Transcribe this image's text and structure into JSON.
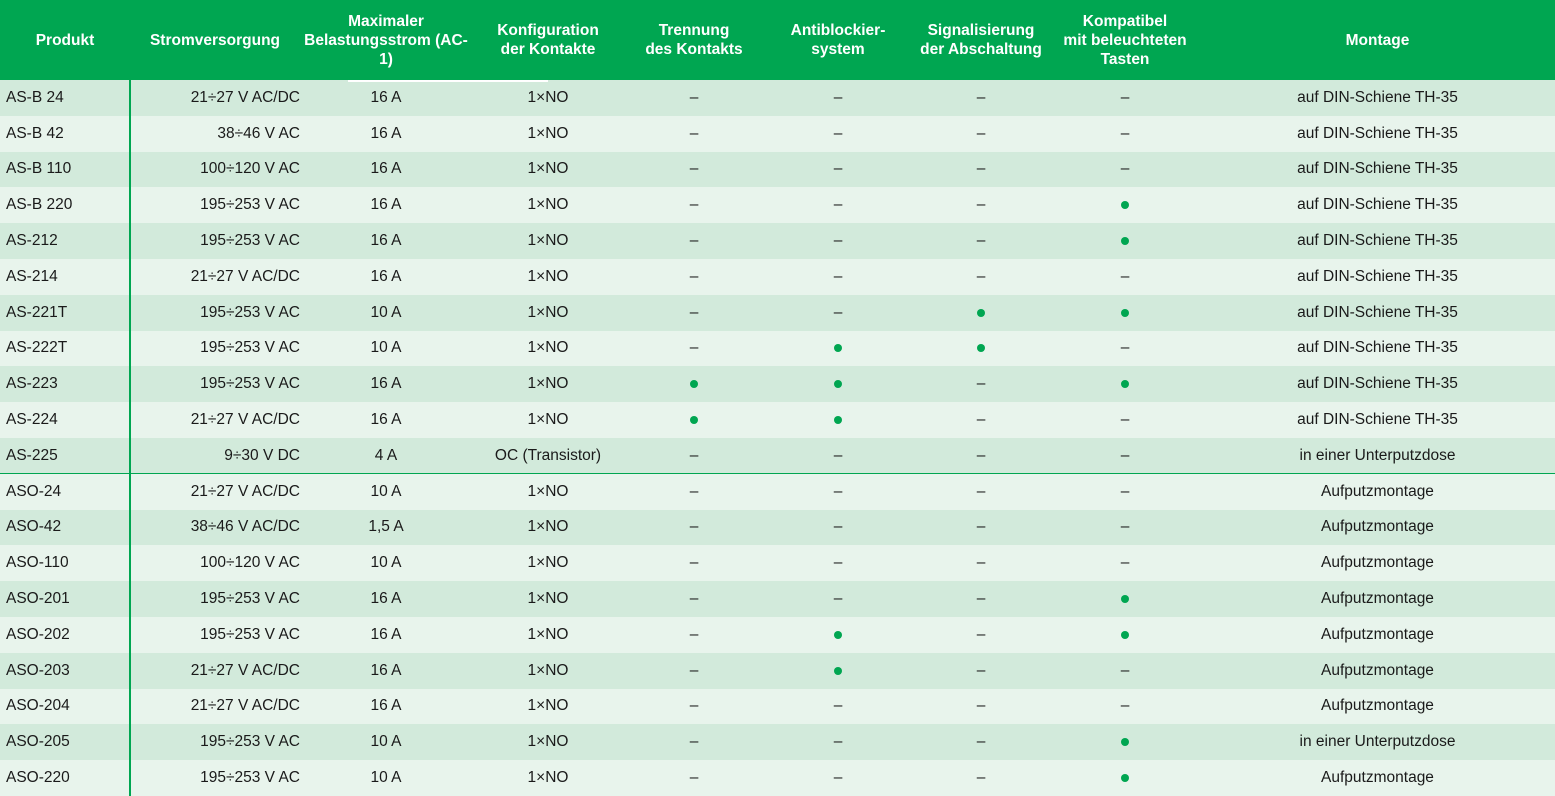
{
  "headers": [
    "Produkt",
    "Stromversorgung",
    "Maximaler\nBelastungsstrom (AC-1)",
    "Konfiguration\nder Kontakte",
    "Trennung\ndes Kontakts",
    "Antiblockier-\nsystem",
    "Signalisierung\nder Abschaltung",
    "Kompatibel\nmit beleuchteten\nTasten",
    "Montage"
  ],
  "legend": {
    "yes": "dot",
    "no": "–"
  },
  "colors": {
    "header_bg": "#00a651",
    "row_dark": "#d2eadb",
    "row_light": "#e8f4ec",
    "dot": "#00a651"
  },
  "rows": [
    {
      "produkt": "AS-B 24",
      "strom": "21÷27 V AC/DC",
      "last": "16 A",
      "konf": "1×NO",
      "trenn": "–",
      "anti": "–",
      "signal": "–",
      "kompat": "–",
      "montage": "auf DIN-Schiene TH-35"
    },
    {
      "produkt": "AS-B 42",
      "strom": "38÷46 V AC",
      "last": "16 A",
      "konf": "1×NO",
      "trenn": "–",
      "anti": "–",
      "signal": "–",
      "kompat": "–",
      "montage": "auf DIN-Schiene TH-35"
    },
    {
      "produkt": "AS-B 110",
      "strom": "100÷120 V AC",
      "last": "16 A",
      "konf": "1×NO",
      "trenn": "–",
      "anti": "–",
      "signal": "–",
      "kompat": "–",
      "montage": "auf DIN-Schiene TH-35"
    },
    {
      "produkt": "AS-B 220",
      "strom": "195÷253 V AC",
      "last": "16 A",
      "konf": "1×NO",
      "trenn": "–",
      "anti": "–",
      "signal": "–",
      "kompat": "dot",
      "montage": "auf DIN-Schiene TH-35"
    },
    {
      "produkt": "AS-212",
      "strom": "195÷253 V AC",
      "last": "16 A",
      "konf": "1×NO",
      "trenn": "–",
      "anti": "–",
      "signal": "–",
      "kompat": "dot",
      "montage": "auf DIN-Schiene TH-35"
    },
    {
      "produkt": "AS-214",
      "strom": "21÷27 V AC/DC",
      "last": "16 A",
      "konf": "1×NO",
      "trenn": "–",
      "anti": "–",
      "signal": "–",
      "kompat": "–",
      "montage": "auf DIN-Schiene TH-35"
    },
    {
      "produkt": "AS-221T",
      "strom": "195÷253 V AC",
      "last": "10 A",
      "konf": "1×NO",
      "trenn": "–",
      "anti": "–",
      "signal": "dot",
      "kompat": "dot",
      "montage": "auf DIN-Schiene TH-35"
    },
    {
      "produkt": "AS-222T",
      "strom": "195÷253 V AC",
      "last": "10 A",
      "konf": "1×NO",
      "trenn": "–",
      "anti": "dot",
      "signal": "dot",
      "kompat": "–",
      "montage": "auf DIN-Schiene TH-35"
    },
    {
      "produkt": "AS-223",
      "strom": "195÷253 V AC",
      "last": "16 A",
      "konf": "1×NO",
      "trenn": "dot",
      "anti": "dot",
      "signal": "–",
      "kompat": "dot",
      "montage": "auf DIN-Schiene TH-35"
    },
    {
      "produkt": "AS-224",
      "strom": "21÷27 V AC/DC",
      "last": "16 A",
      "konf": "1×NO",
      "trenn": "dot",
      "anti": "dot",
      "signal": "–",
      "kompat": "–",
      "montage": "auf DIN-Schiene TH-35"
    },
    {
      "produkt": "AS-225",
      "strom": "9÷30 V DC",
      "last": "4 A",
      "konf": "OC (Transistor)",
      "trenn": "–",
      "anti": "–",
      "signal": "–",
      "kompat": "–",
      "montage": "in einer Unterputzdose"
    },
    {
      "produkt": "ASO-24",
      "strom": "21÷27 V AC/DC",
      "last": "10 A",
      "konf": "1×NO",
      "trenn": "–",
      "anti": "–",
      "signal": "–",
      "kompat": "–",
      "montage": "Aufputzmontage",
      "group_start": true
    },
    {
      "produkt": "ASO-42",
      "strom": "38÷46 V AC/DC",
      "last": "1,5 A",
      "konf": "1×NO",
      "trenn": "–",
      "anti": "–",
      "signal": "–",
      "kompat": "–",
      "montage": "Aufputzmontage"
    },
    {
      "produkt": "ASO-110",
      "strom": "100÷120 V AC",
      "last": "10 A",
      "konf": "1×NO",
      "trenn": "–",
      "anti": "–",
      "signal": "–",
      "kompat": "–",
      "montage": "Aufputzmontage"
    },
    {
      "produkt": "ASO-201",
      "strom": "195÷253 V AC",
      "last": "16 A",
      "konf": "1×NO",
      "trenn": "–",
      "anti": "–",
      "signal": "–",
      "kompat": "dot",
      "montage": "Aufputzmontage"
    },
    {
      "produkt": "ASO-202",
      "strom": "195÷253 V AC",
      "last": "16 A",
      "konf": "1×NO",
      "trenn": "–",
      "anti": "dot",
      "signal": "–",
      "kompat": "dot",
      "montage": "Aufputzmontage"
    },
    {
      "produkt": "ASO-203",
      "strom": "21÷27 V AC/DC",
      "last": "16 A",
      "konf": "1×NO",
      "trenn": "–",
      "anti": "dot",
      "signal": "–",
      "kompat": "–",
      "montage": "Aufputzmontage"
    },
    {
      "produkt": "ASO-204",
      "strom": "21÷27 V AC/DC",
      "last": "16 A",
      "konf": "1×NO",
      "trenn": "–",
      "anti": "–",
      "signal": "–",
      "kompat": "–",
      "montage": "Aufputzmontage"
    },
    {
      "produkt": "ASO-205",
      "strom": "195÷253 V AC",
      "last": "10 A",
      "konf": "1×NO",
      "trenn": "–",
      "anti": "–",
      "signal": "–",
      "kompat": "dot",
      "montage": "in einer Unterputzdose"
    },
    {
      "produkt": "ASO-220",
      "strom": "195÷253 V AC",
      "last": "10 A",
      "konf": "1×NO",
      "trenn": "–",
      "anti": "–",
      "signal": "–",
      "kompat": "dot",
      "montage": "Aufputzmontage"
    }
  ]
}
